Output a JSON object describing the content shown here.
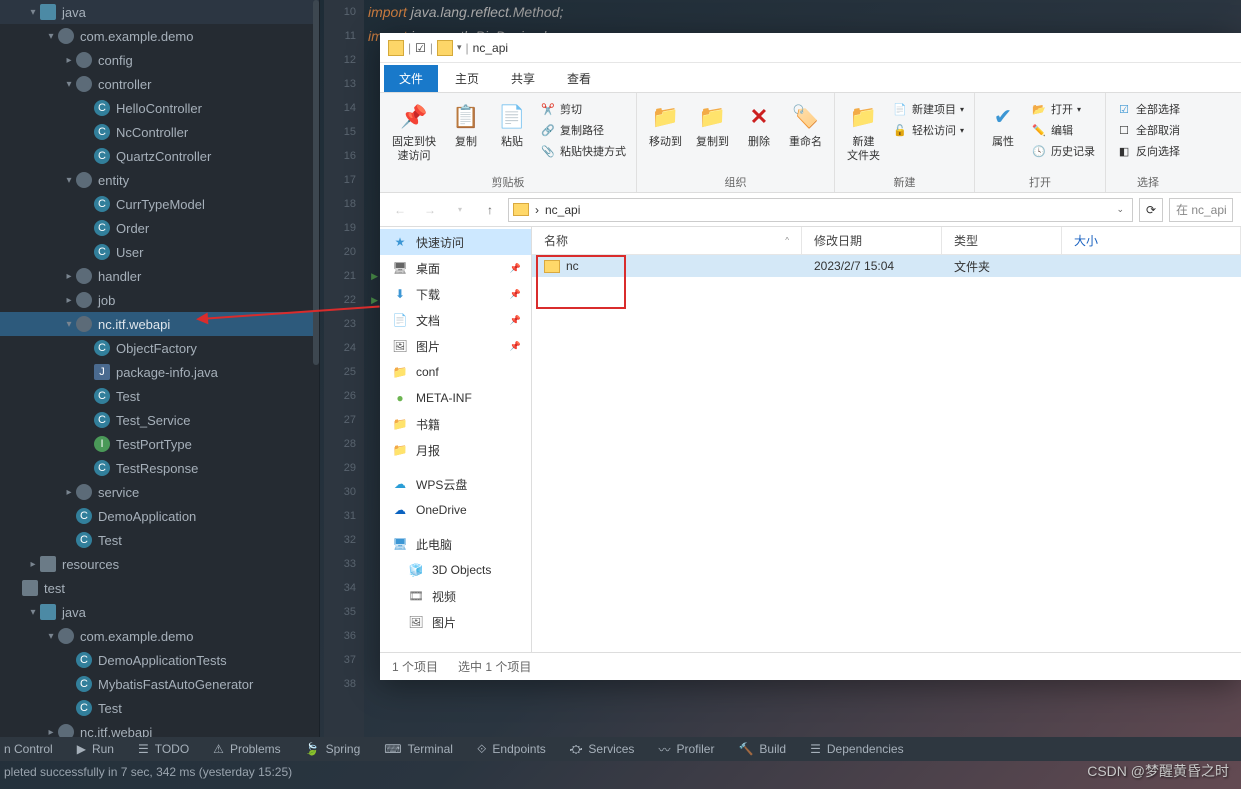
{
  "tree": {
    "nodes": [
      {
        "d": 1,
        "c": "▾",
        "i": "folder j",
        "t": "java"
      },
      {
        "d": 2,
        "c": "▾",
        "i": "pkg",
        "t": "com.example.demo"
      },
      {
        "d": 3,
        "c": "▸",
        "i": "pkg",
        "t": "config"
      },
      {
        "d": 3,
        "c": "▾",
        "i": "pkg",
        "t": "controller"
      },
      {
        "d": 4,
        "c": "",
        "i": "cls",
        "t": "HelloController"
      },
      {
        "d": 4,
        "c": "",
        "i": "cls",
        "t": "NcController"
      },
      {
        "d": 4,
        "c": "",
        "i": "cls",
        "t": "QuartzController"
      },
      {
        "d": 3,
        "c": "▾",
        "i": "pkg",
        "t": "entity"
      },
      {
        "d": 4,
        "c": "",
        "i": "cls",
        "t": "CurrTypeModel"
      },
      {
        "d": 4,
        "c": "",
        "i": "cls",
        "t": "Order"
      },
      {
        "d": 4,
        "c": "",
        "i": "cls",
        "t": "User"
      },
      {
        "d": 3,
        "c": "▸",
        "i": "pkg",
        "t": "handler"
      },
      {
        "d": 3,
        "c": "▸",
        "i": "pkg",
        "t": "job"
      },
      {
        "d": 3,
        "c": "▾",
        "i": "pkg",
        "t": "nc.itf.webapi",
        "sel": true
      },
      {
        "d": 4,
        "c": "",
        "i": "cls",
        "t": "ObjectFactory"
      },
      {
        "d": 4,
        "c": "",
        "i": "jfile",
        "t": "package-info.java"
      },
      {
        "d": 4,
        "c": "",
        "i": "cls",
        "t": "Test"
      },
      {
        "d": 4,
        "c": "",
        "i": "cls",
        "t": "Test_Service"
      },
      {
        "d": 4,
        "c": "",
        "i": "intf",
        "t": "TestPortType"
      },
      {
        "d": 4,
        "c": "",
        "i": "cls",
        "t": "TestResponse"
      },
      {
        "d": 3,
        "c": "▸",
        "i": "pkg",
        "t": "service"
      },
      {
        "d": 3,
        "c": "",
        "i": "cls",
        "t": "DemoApplication"
      },
      {
        "d": 3,
        "c": "",
        "i": "cls",
        "t": "Test"
      },
      {
        "d": 1,
        "c": "▸",
        "i": "folder",
        "t": "resources"
      },
      {
        "d": 0,
        "c": "",
        "i": "folder",
        "t": "test"
      },
      {
        "d": 1,
        "c": "▾",
        "i": "folder j",
        "t": "java"
      },
      {
        "d": 2,
        "c": "▾",
        "i": "pkg",
        "t": "com.example.demo"
      },
      {
        "d": 3,
        "c": "",
        "i": "cls",
        "t": "DemoApplicationTests"
      },
      {
        "d": 3,
        "c": "",
        "i": "cls",
        "t": "MybatisFastAutoGenerator"
      },
      {
        "d": 3,
        "c": "",
        "i": "cls",
        "t": "Test"
      },
      {
        "d": 2,
        "c": "▸",
        "i": "pkg",
        "t": "nc.itf.webapi"
      }
    ]
  },
  "gutter": {
    "start": 10,
    "end": 38,
    "play": [
      21,
      22
    ]
  },
  "code": [
    "import java.lang.reflect.Method;",
    "import java.math.BigDecimal;"
  ],
  "explorer": {
    "title_path": "nc_api",
    "tabs": [
      "文件",
      "主页",
      "共享",
      "查看"
    ],
    "ribbon": {
      "s1": {
        "label": "剪贴板",
        "pin": "固定到快\n速访问",
        "copy": "复制",
        "paste": "粘贴",
        "cut": "剪切",
        "copypath": "复制路径",
        "pasteshort": "粘贴快捷方式"
      },
      "s2": {
        "label": "组织",
        "moveto": "移动到",
        "copyto": "复制到",
        "delete": "删除",
        "rename": "重命名"
      },
      "s3": {
        "label": "新建",
        "newfolder": "新建\n文件夹",
        "newitem": "新建项目",
        "easyaccess": "轻松访问"
      },
      "s4": {
        "label": "打开",
        "props": "属性",
        "open": "打开",
        "edit": "编辑",
        "history": "历史记录"
      },
      "s5": {
        "label": "选择",
        "selectall": "全部选择",
        "selectnone": "全部取消",
        "invert": "反向选择"
      }
    },
    "nav": {
      "path_sep": "›",
      "path_item": "nc_api",
      "search": "在 nc_api"
    },
    "sidebar": [
      {
        "t": "快速访问",
        "i": "★",
        "c": "#3c96d4",
        "sel": true
      },
      {
        "t": "桌面",
        "i": "🖥",
        "pin": true
      },
      {
        "t": "下载",
        "i": "⬇",
        "c": "#3c96d4",
        "pin": true
      },
      {
        "t": "文档",
        "i": "📄",
        "pin": true
      },
      {
        "t": "图片",
        "i": "🖼",
        "pin": true
      },
      {
        "t": "conf",
        "i": "📁",
        "c": "#ffd666"
      },
      {
        "t": "META-INF",
        "i": "●",
        "c": "#6db552"
      },
      {
        "t": "书籍",
        "i": "📁",
        "c": "#ffd666"
      },
      {
        "t": "月报",
        "i": "📁",
        "c": "#ffd666"
      },
      {
        "t": "",
        "spacer": true
      },
      {
        "t": "WPS云盘",
        "i": "☁",
        "c": "#2a9dd6"
      },
      {
        "t": "OneDrive",
        "i": "☁",
        "c": "#0a62c0"
      },
      {
        "t": "",
        "spacer": true
      },
      {
        "t": "此电脑",
        "i": "🖥",
        "c": "#3c96d4"
      },
      {
        "t": "3D Objects",
        "i": "🧊",
        "sub": true
      },
      {
        "t": "视频",
        "i": "🎞",
        "sub": true
      },
      {
        "t": "图片",
        "i": "🖼",
        "sub": true
      }
    ],
    "cols": {
      "name": "名称",
      "date": "修改日期",
      "type": "类型",
      "size": "大小"
    },
    "rows": [
      {
        "name": "nc",
        "date": "2023/2/7 15:04",
        "type": "文件夹",
        "size": "",
        "sel": true
      }
    ],
    "status": {
      "count": "1 个项目",
      "sel": "选中 1 个项目"
    }
  },
  "bottom": [
    "n Control",
    "Run",
    "TODO",
    "Problems",
    "Spring",
    "Terminal",
    "Endpoints",
    "Services",
    "Profiler",
    "Build",
    "Dependencies"
  ],
  "status": "pleted successfully in 7 sec, 342 ms (yesterday 15:25)",
  "watermark": "CSDN @梦醒黄昏之时"
}
